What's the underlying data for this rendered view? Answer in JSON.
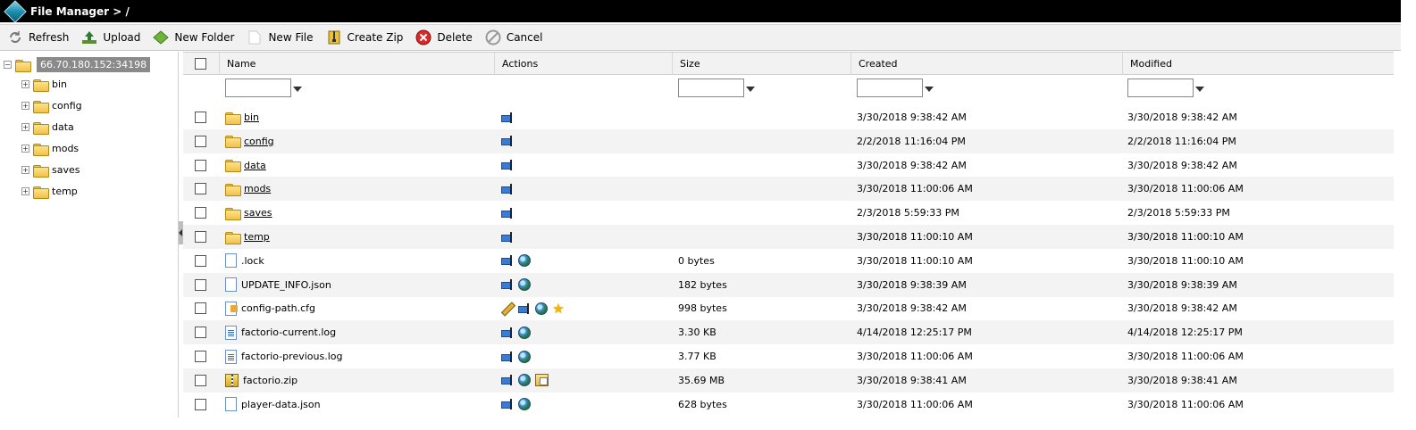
{
  "title": "File Manager > /",
  "toolbar": {
    "refresh": "Refresh",
    "upload": "Upload",
    "new_folder": "New Folder",
    "new_file": "New File",
    "create_zip": "Create Zip",
    "delete": "Delete",
    "cancel": "Cancel"
  },
  "tree": {
    "root": "66.70.180.152:34198",
    "items": [
      "bin",
      "config",
      "data",
      "mods",
      "saves",
      "temp"
    ]
  },
  "grid": {
    "columns": {
      "name": "Name",
      "actions": "Actions",
      "size": "Size",
      "created": "Created",
      "modified": "Modified"
    },
    "rows": [
      {
        "name": "bin",
        "type": "folder",
        "actions": [
          "rename-icon"
        ],
        "size": "",
        "created": "3/30/2018 9:38:42 AM",
        "modified": "3/30/2018 9:38:42 AM"
      },
      {
        "name": "config",
        "type": "folder",
        "actions": [
          "rename-icon"
        ],
        "size": "",
        "created": "2/2/2018 11:16:04 PM",
        "modified": "2/2/2018 11:16:04 PM"
      },
      {
        "name": "data",
        "type": "folder",
        "actions": [
          "rename-icon"
        ],
        "size": "",
        "created": "3/30/2018 9:38:42 AM",
        "modified": "3/30/2018 9:38:42 AM"
      },
      {
        "name": "mods",
        "type": "folder",
        "actions": [
          "rename-icon"
        ],
        "size": "",
        "created": "3/30/2018 11:00:06 AM",
        "modified": "3/30/2018 11:00:06 AM"
      },
      {
        "name": "saves",
        "type": "folder",
        "actions": [
          "rename-icon"
        ],
        "size": "",
        "created": "2/3/2018 5:59:33 PM",
        "modified": "2/3/2018 5:59:33 PM"
      },
      {
        "name": "temp",
        "type": "folder",
        "actions": [
          "rename-icon"
        ],
        "size": "",
        "created": "3/30/2018 11:00:10 AM",
        "modified": "3/30/2018 11:00:10 AM"
      },
      {
        "name": ".lock",
        "type": "file",
        "actions": [
          "rename-icon",
          "globe-icon"
        ],
        "size": "0 bytes",
        "created": "3/30/2018 11:00:10 AM",
        "modified": "3/30/2018 11:00:10 AM"
      },
      {
        "name": "UPDATE_INFO.json",
        "type": "file",
        "actions": [
          "rename-icon",
          "globe-icon"
        ],
        "size": "182 bytes",
        "created": "3/30/2018 9:38:39 AM",
        "modified": "3/30/2018 9:38:39 AM"
      },
      {
        "name": "config-path.cfg",
        "type": "cfg",
        "actions": [
          "pencil-icon",
          "rename-icon",
          "globe-icon",
          "star-icon"
        ],
        "size": "998 bytes",
        "created": "3/30/2018 9:38:42 AM",
        "modified": "3/30/2018 9:38:42 AM"
      },
      {
        "name": "factorio-current.log",
        "type": "log",
        "actions": [
          "rename-icon",
          "globe-icon"
        ],
        "size": "3.30 KB",
        "created": "4/14/2018 12:25:17 PM",
        "modified": "4/14/2018 12:25:17 PM"
      },
      {
        "name": "factorio-previous.log",
        "type": "log",
        "actions": [
          "rename-icon",
          "globe-icon"
        ],
        "size": "3.77 KB",
        "created": "3/30/2018 11:00:06 AM",
        "modified": "3/30/2018 11:00:06 AM"
      },
      {
        "name": "factorio.zip",
        "type": "zip",
        "actions": [
          "rename-icon",
          "globe-icon",
          "unzip-icon"
        ],
        "size": "35.69 MB",
        "created": "3/30/2018 9:38:41 AM",
        "modified": "3/30/2018 9:38:41 AM"
      },
      {
        "name": "player-data.json",
        "type": "file",
        "actions": [
          "rename-icon",
          "globe-icon"
        ],
        "size": "628 bytes",
        "created": "3/30/2018 11:00:06 AM",
        "modified": "3/30/2018 11:00:06 AM"
      }
    ]
  }
}
